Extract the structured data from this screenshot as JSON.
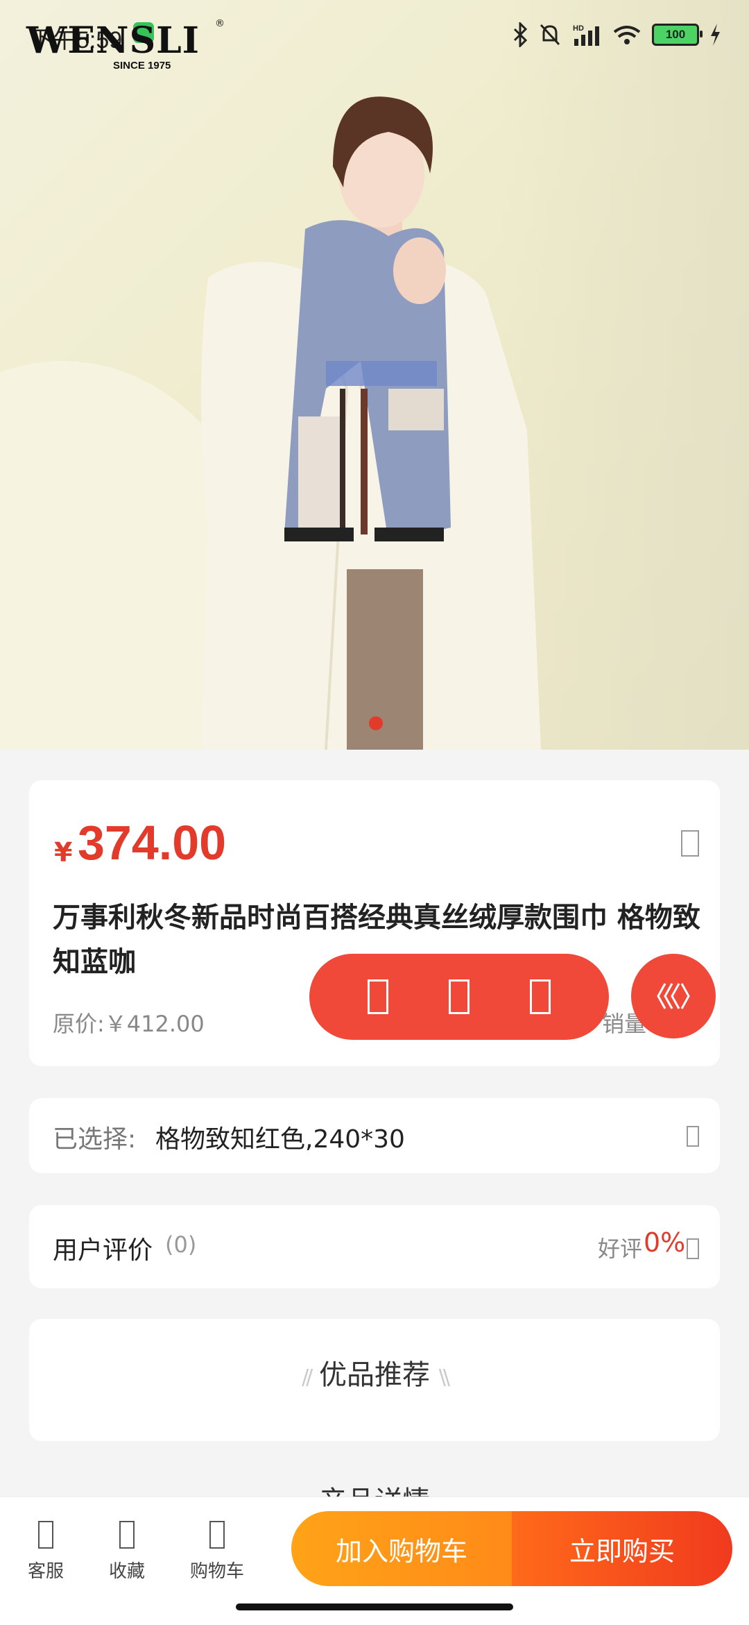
{
  "status_bar": {
    "time": "下午5:59",
    "battery": "100"
  },
  "hero": {
    "brand": "WENSLI",
    "brand_since": "SINCE 1975",
    "brand_mark": "®"
  },
  "product": {
    "currency": "¥",
    "price": "374.00",
    "title": "万事利秋冬新品时尚百搭经典真丝绒厚款围巾 格物致知蓝咖",
    "original_price": "原价:￥412.00",
    "sales_label": "销量"
  },
  "selection": {
    "label": "已选择:",
    "value": "格物致知红色,240*30"
  },
  "reviews": {
    "label": "用户评价",
    "count": "(0)",
    "good_label": "好评",
    "good_pct": "0%"
  },
  "recommend": {
    "title": "优品推荐"
  },
  "details": {
    "title": "产品详情"
  },
  "bottom_nav": {
    "items": [
      {
        "label": "客服",
        "icon": "customer-service-icon"
      },
      {
        "label": "收藏",
        "icon": "favorite-icon"
      },
      {
        "label": "购物车",
        "icon": "cart-icon"
      }
    ],
    "add_to_cart": "加入购物车",
    "buy_now": "立即购买"
  },
  "colors": {
    "accent": "#e23b2c",
    "cart_button": "#ff9a18",
    "buy_button": "#f04a1e"
  }
}
